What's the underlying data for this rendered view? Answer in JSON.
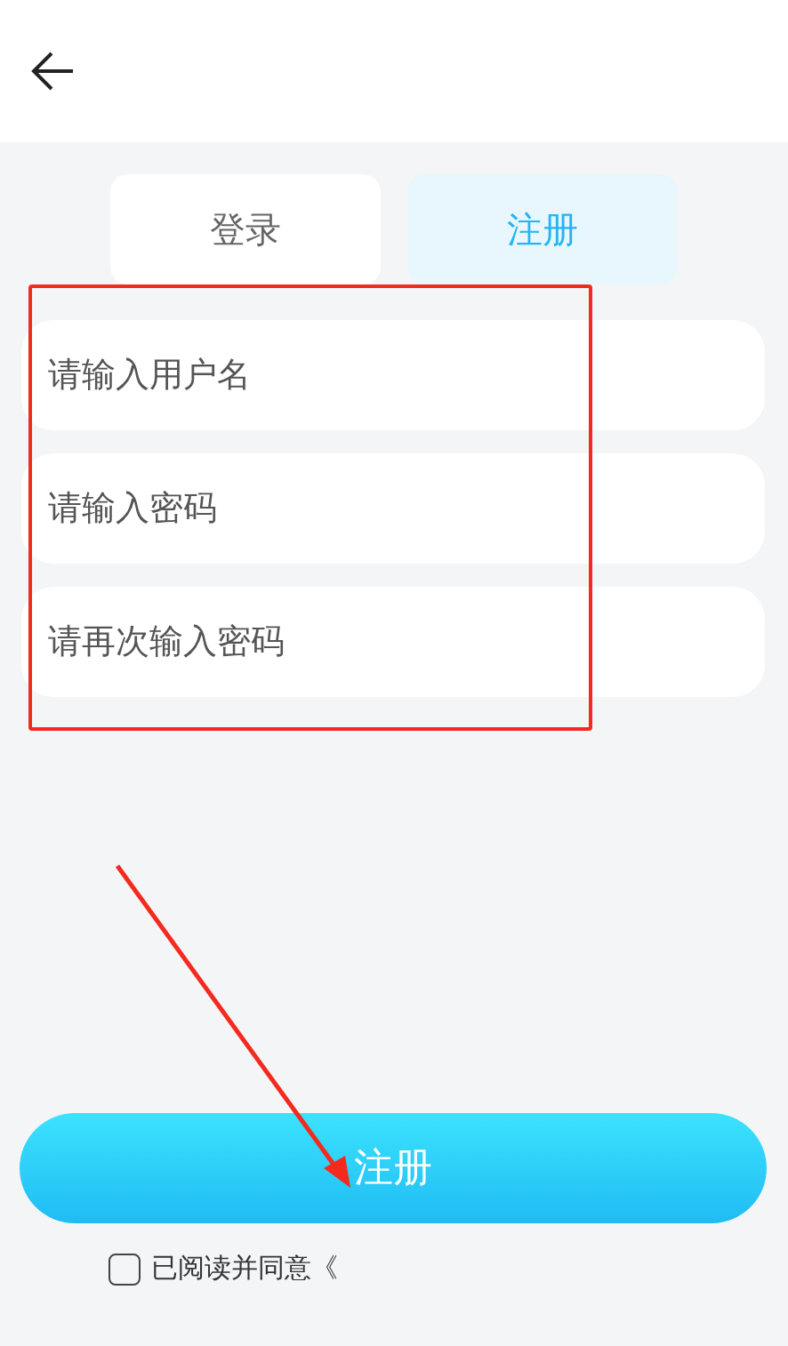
{
  "tabs": [
    {
      "label": "登录",
      "selected": false
    },
    {
      "label": "注册",
      "selected": true
    }
  ],
  "fields": [
    {
      "placeholder": "请输入用户名"
    },
    {
      "placeholder": "请输入密码"
    },
    {
      "placeholder": "请再次输入密码"
    }
  ],
  "submit_button": "注册",
  "agreement": {
    "checked": false,
    "text": "已阅读并同意《"
  }
}
